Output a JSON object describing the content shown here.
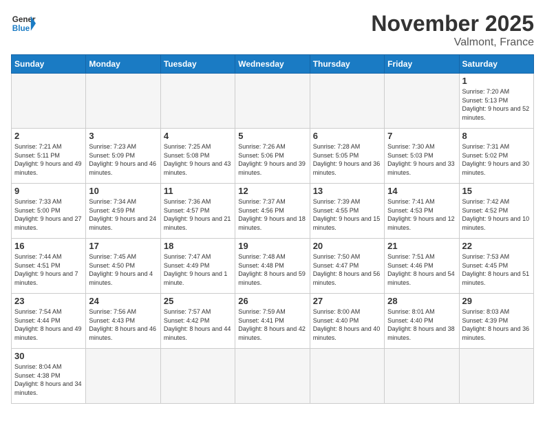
{
  "header": {
    "logo_general": "General",
    "logo_blue": "Blue",
    "month_title": "November 2025",
    "location": "Valmont, France"
  },
  "days_of_week": [
    "Sunday",
    "Monday",
    "Tuesday",
    "Wednesday",
    "Thursday",
    "Friday",
    "Saturday"
  ],
  "weeks": [
    [
      {
        "day": null,
        "info": ""
      },
      {
        "day": null,
        "info": ""
      },
      {
        "day": null,
        "info": ""
      },
      {
        "day": null,
        "info": ""
      },
      {
        "day": null,
        "info": ""
      },
      {
        "day": null,
        "info": ""
      },
      {
        "day": "1",
        "info": "Sunrise: 7:20 AM\nSunset: 5:13 PM\nDaylight: 9 hours\nand 52 minutes."
      }
    ],
    [
      {
        "day": "2",
        "info": "Sunrise: 7:21 AM\nSunset: 5:11 PM\nDaylight: 9 hours\nand 49 minutes."
      },
      {
        "day": "3",
        "info": "Sunrise: 7:23 AM\nSunset: 5:09 PM\nDaylight: 9 hours\nand 46 minutes."
      },
      {
        "day": "4",
        "info": "Sunrise: 7:25 AM\nSunset: 5:08 PM\nDaylight: 9 hours\nand 43 minutes."
      },
      {
        "day": "5",
        "info": "Sunrise: 7:26 AM\nSunset: 5:06 PM\nDaylight: 9 hours\nand 39 minutes."
      },
      {
        "day": "6",
        "info": "Sunrise: 7:28 AM\nSunset: 5:05 PM\nDaylight: 9 hours\nand 36 minutes."
      },
      {
        "day": "7",
        "info": "Sunrise: 7:30 AM\nSunset: 5:03 PM\nDaylight: 9 hours\nand 33 minutes."
      },
      {
        "day": "8",
        "info": "Sunrise: 7:31 AM\nSunset: 5:02 PM\nDaylight: 9 hours\nand 30 minutes."
      }
    ],
    [
      {
        "day": "9",
        "info": "Sunrise: 7:33 AM\nSunset: 5:00 PM\nDaylight: 9 hours\nand 27 minutes."
      },
      {
        "day": "10",
        "info": "Sunrise: 7:34 AM\nSunset: 4:59 PM\nDaylight: 9 hours\nand 24 minutes."
      },
      {
        "day": "11",
        "info": "Sunrise: 7:36 AM\nSunset: 4:57 PM\nDaylight: 9 hours\nand 21 minutes."
      },
      {
        "day": "12",
        "info": "Sunrise: 7:37 AM\nSunset: 4:56 PM\nDaylight: 9 hours\nand 18 minutes."
      },
      {
        "day": "13",
        "info": "Sunrise: 7:39 AM\nSunset: 4:55 PM\nDaylight: 9 hours\nand 15 minutes."
      },
      {
        "day": "14",
        "info": "Sunrise: 7:41 AM\nSunset: 4:53 PM\nDaylight: 9 hours\nand 12 minutes."
      },
      {
        "day": "15",
        "info": "Sunrise: 7:42 AM\nSunset: 4:52 PM\nDaylight: 9 hours\nand 10 minutes."
      }
    ],
    [
      {
        "day": "16",
        "info": "Sunrise: 7:44 AM\nSunset: 4:51 PM\nDaylight: 9 hours\nand 7 minutes."
      },
      {
        "day": "17",
        "info": "Sunrise: 7:45 AM\nSunset: 4:50 PM\nDaylight: 9 hours\nand 4 minutes."
      },
      {
        "day": "18",
        "info": "Sunrise: 7:47 AM\nSunset: 4:49 PM\nDaylight: 9 hours\nand 1 minute."
      },
      {
        "day": "19",
        "info": "Sunrise: 7:48 AM\nSunset: 4:48 PM\nDaylight: 8 hours\nand 59 minutes."
      },
      {
        "day": "20",
        "info": "Sunrise: 7:50 AM\nSunset: 4:47 PM\nDaylight: 8 hours\nand 56 minutes."
      },
      {
        "day": "21",
        "info": "Sunrise: 7:51 AM\nSunset: 4:46 PM\nDaylight: 8 hours\nand 54 minutes."
      },
      {
        "day": "22",
        "info": "Sunrise: 7:53 AM\nSunset: 4:45 PM\nDaylight: 8 hours\nand 51 minutes."
      }
    ],
    [
      {
        "day": "23",
        "info": "Sunrise: 7:54 AM\nSunset: 4:44 PM\nDaylight: 8 hours\nand 49 minutes."
      },
      {
        "day": "24",
        "info": "Sunrise: 7:56 AM\nSunset: 4:43 PM\nDaylight: 8 hours\nand 46 minutes."
      },
      {
        "day": "25",
        "info": "Sunrise: 7:57 AM\nSunset: 4:42 PM\nDaylight: 8 hours\nand 44 minutes."
      },
      {
        "day": "26",
        "info": "Sunrise: 7:59 AM\nSunset: 4:41 PM\nDaylight: 8 hours\nand 42 minutes."
      },
      {
        "day": "27",
        "info": "Sunrise: 8:00 AM\nSunset: 4:40 PM\nDaylight: 8 hours\nand 40 minutes."
      },
      {
        "day": "28",
        "info": "Sunrise: 8:01 AM\nSunset: 4:40 PM\nDaylight: 8 hours\nand 38 minutes."
      },
      {
        "day": "29",
        "info": "Sunrise: 8:03 AM\nSunset: 4:39 PM\nDaylight: 8 hours\nand 36 minutes."
      }
    ],
    [
      {
        "day": "30",
        "info": "Sunrise: 8:04 AM\nSunset: 4:38 PM\nDaylight: 8 hours\nand 34 minutes."
      },
      {
        "day": null,
        "info": ""
      },
      {
        "day": null,
        "info": ""
      },
      {
        "day": null,
        "info": ""
      },
      {
        "day": null,
        "info": ""
      },
      {
        "day": null,
        "info": ""
      },
      {
        "day": null,
        "info": ""
      }
    ]
  ]
}
